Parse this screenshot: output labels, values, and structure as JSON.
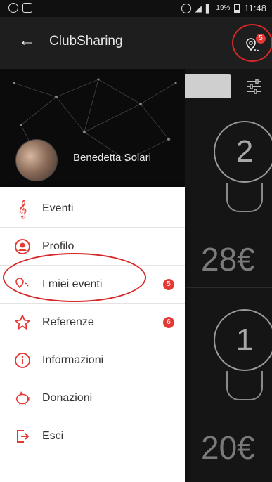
{
  "status_bar": {
    "battery": "19%",
    "time": "11:48"
  },
  "app_bar": {
    "title": "ClubSharing",
    "location_badge": "5"
  },
  "drawer": {
    "user_name": "Benedetta Solari",
    "items": [
      {
        "label": "Eventi",
        "icon": "music-clef-icon",
        "badge": ""
      },
      {
        "label": "Profilo",
        "icon": "user-circle-icon",
        "badge": ""
      },
      {
        "label": "I miei eventi",
        "icon": "location-pins-icon",
        "badge": "5"
      },
      {
        "label": "Referenze",
        "icon": "star-icon",
        "badge": "6"
      },
      {
        "label": "Informazioni",
        "icon": "info-icon",
        "badge": ""
      },
      {
        "label": "Donazioni",
        "icon": "piggy-bank-icon",
        "badge": ""
      },
      {
        "label": "Esci",
        "icon": "exit-icon",
        "badge": ""
      }
    ]
  },
  "background_cards": [
    {
      "number": "2",
      "price": "28€"
    },
    {
      "number": "1",
      "price": "20€"
    }
  ],
  "colors": {
    "accent": "#e53935",
    "annotation": "#d62828",
    "drawer_bg": "#ffffff"
  }
}
